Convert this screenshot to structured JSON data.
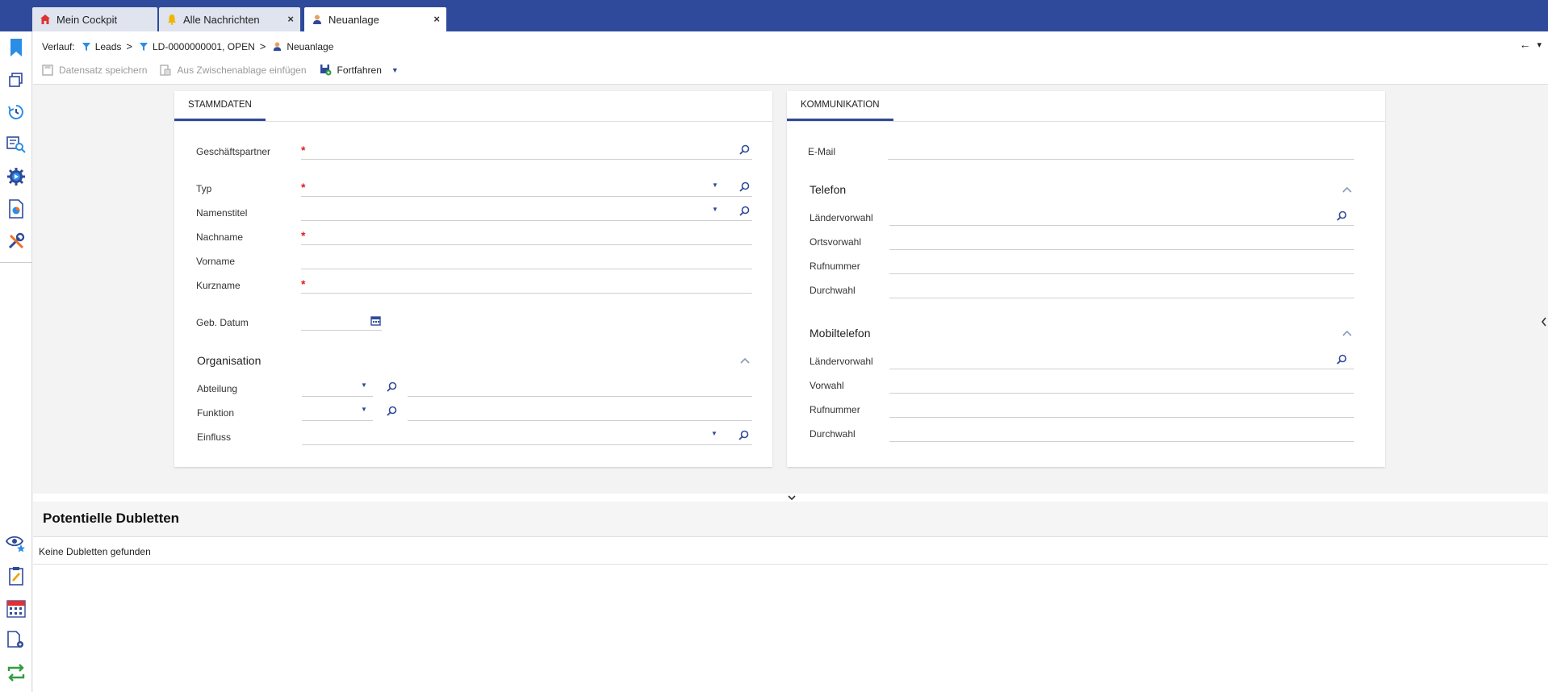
{
  "tabs": [
    {
      "label": "Mein Cockpit",
      "icon": "home-icon",
      "closable": false,
      "active": false
    },
    {
      "label": "Alle Nachrichten",
      "icon": "bell-icon",
      "closable": true,
      "active": false
    },
    {
      "label": "Neuanlage",
      "icon": "person-icon",
      "closable": true,
      "active": true
    }
  ],
  "tab_close_glyph": "×",
  "history": {
    "label": "Verlauf:",
    "crumbs": [
      "Leads",
      "LD-0000000001, OPEN",
      "Neuanlage"
    ],
    "separator": ">",
    "back_glyph": "←",
    "menu_glyph": "▾"
  },
  "toolbar": {
    "save_label": "Datensatz speichern",
    "paste_label": "Aus Zwischenablage einfügen",
    "continue_label": "Fortfahren"
  },
  "stammdaten": {
    "tab_label": "STAMMDATEN",
    "fields": {
      "geschaeftspartner": "Geschäftspartner",
      "typ": "Typ",
      "namenstitel": "Namenstitel",
      "nachname": "Nachname",
      "vorname": "Vorname",
      "kurzname": "Kurzname",
      "geb_datum": "Geb. Datum"
    },
    "required_mark": "*",
    "organisation": {
      "title": "Organisation",
      "abteilung": "Abteilung",
      "funktion": "Funktion",
      "einfluss": "Einfluss"
    }
  },
  "kommunikation": {
    "tab_label": "KOMMUNIKATION",
    "email": "E-Mail",
    "telefon": {
      "title": "Telefon",
      "laendervorwahl": "Ländervorwahl",
      "ortsvorwahl": "Ortsvorwahl",
      "rufnummer": "Rufnummer",
      "durchwahl": "Durchwahl"
    },
    "mobiltelefon": {
      "title": "Mobiltelefon",
      "laendervorwahl": "Ländervorwahl",
      "vorwahl": "Vorwahl",
      "rufnummer": "Rufnummer",
      "durchwahl": "Durchwahl"
    }
  },
  "dubletten": {
    "title": "Potentielle Dubletten",
    "empty_text": "Keine Dubletten gefunden"
  },
  "colors": {
    "brand": "#2f4a9a",
    "required": "#e02020"
  }
}
